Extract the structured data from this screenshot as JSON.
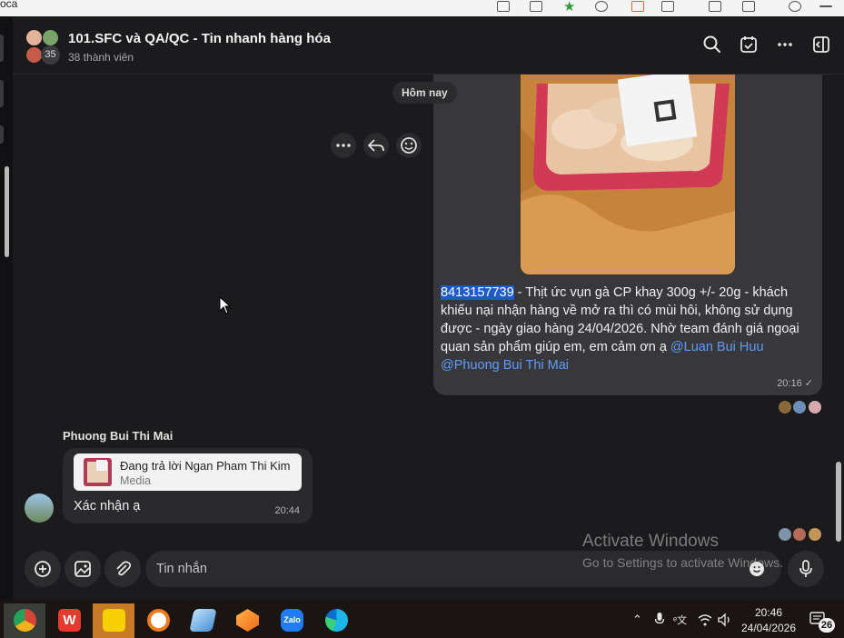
{
  "browser": {
    "tab_fragment": "oca"
  },
  "group": {
    "title": "101.SFC và QA/QC - Tin nhanh hàng hóa",
    "members": "38 thành viên",
    "avatar_count": "35"
  },
  "chat": {
    "date_chip": "Hôm nay",
    "outgoing": {
      "order_id": "8413157739",
      "text_after_id": " -  Thịt ức vụn gà CP khay 300g +/- 20g - khách khiếu nại nhận hàng về mở ra thì có mùi hôi, không sử dụng được - ngày giao hàng 24/04/2026. Nhờ team đánh giá ngoại quan sản phẩm giúp em, em cảm ơn ạ ",
      "mention_1": "@Luan Bui Huu",
      "mention_2": "@Phuong Bui Thi Mai",
      "time": "20:16"
    },
    "incoming": {
      "sender": "Phuong Bui Thi Mai",
      "reply_title": "Đang trả lời Ngan Pham Thi Kim",
      "reply_sub": "Media",
      "text": "Xác nhận ạ",
      "time": "20:44"
    }
  },
  "composer": {
    "placeholder": "Tin nhắn"
  },
  "watermark": {
    "line1": "Activate Windows",
    "line2": "Go to Settings to activate Windows."
  },
  "taskbar": {
    "apps": [
      "chrome-icon",
      "wps-icon",
      "sticky-notes-icon",
      "vpn-icon",
      "notes-icon",
      "figma-icon",
      "zalo-icon",
      "edge-icon"
    ],
    "zalo_label": "Zalo",
    "time": "20:46",
    "date": "24/04/2026",
    "notification_count": "26"
  },
  "colors": {
    "accent": "#1e5bc6",
    "mention": "#5d9cf5",
    "bubble_out": "#38383c",
    "bubble_in": "#2a2a2d"
  }
}
